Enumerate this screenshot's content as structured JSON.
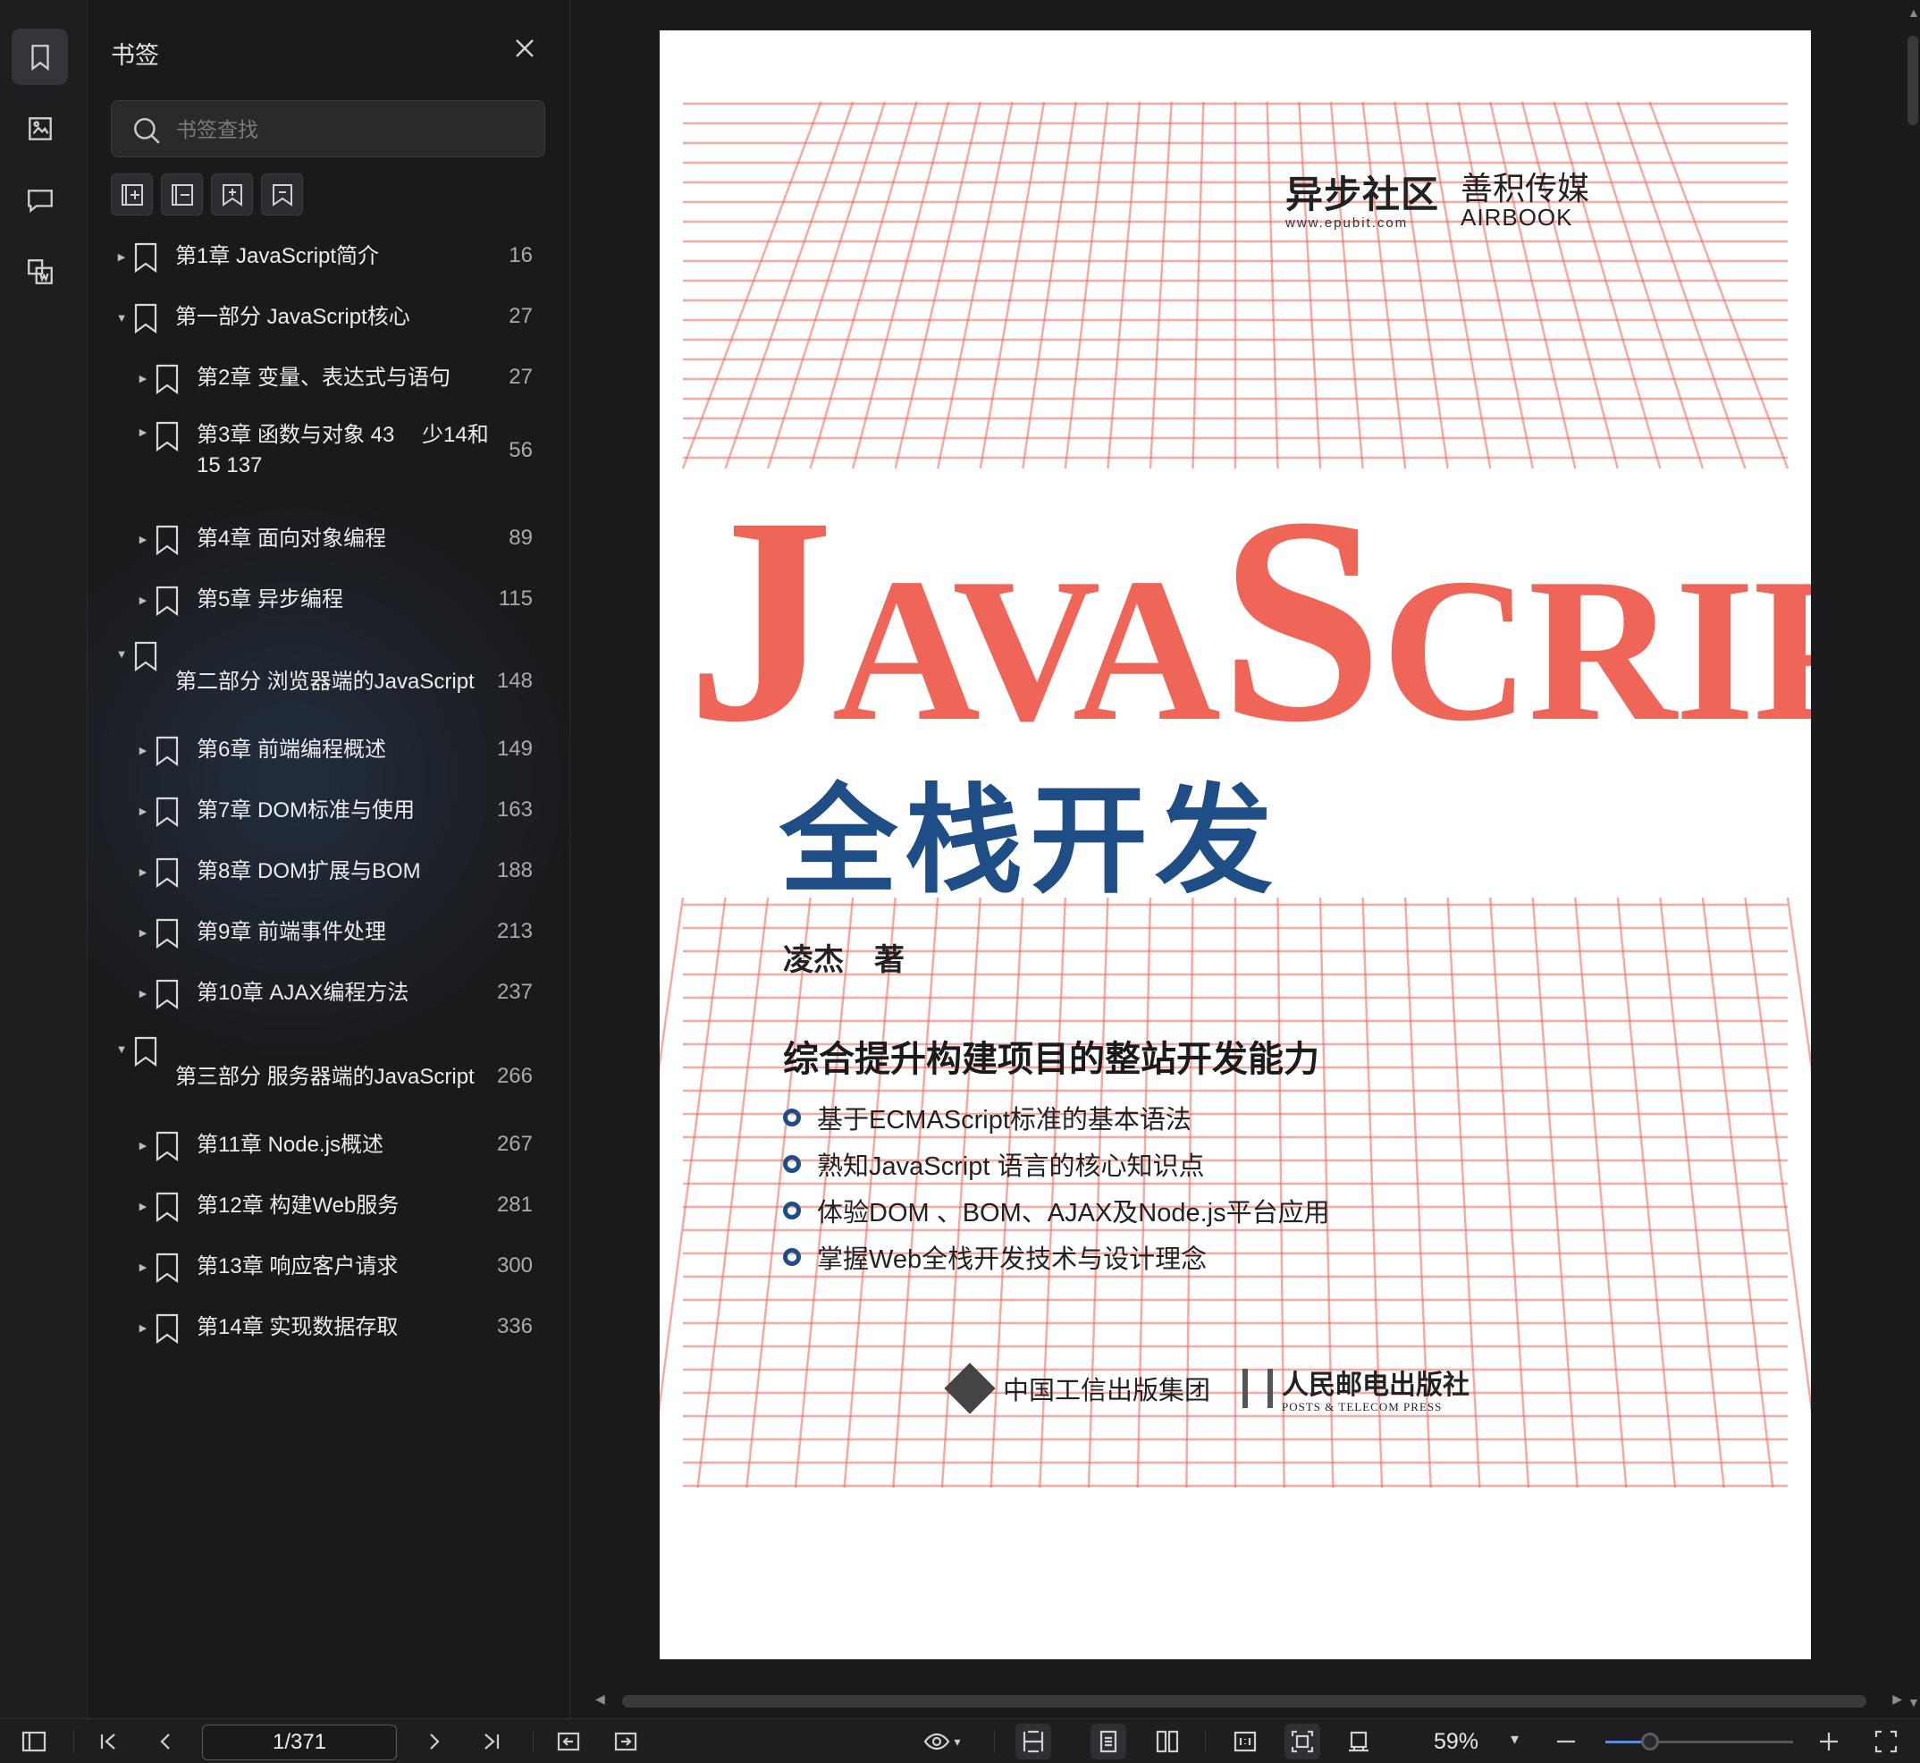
{
  "sidebar": {
    "title": "书签",
    "search_placeholder": "书签查找",
    "rail_icons": [
      "bookmark-icon",
      "image-icon",
      "comment-icon",
      "extract-icon"
    ],
    "tool_icons": [
      "expand-all-icon",
      "collapse-all-icon",
      "add-bookmark-icon",
      "remove-bookmark-icon"
    ]
  },
  "bookmarks": [
    {
      "label": "第1章 JavaScript简介",
      "page": "16",
      "level": 0,
      "expanded": false
    },
    {
      "label": "第一部分 JavaScript核心",
      "page": "27",
      "level": 0,
      "expanded": true
    },
    {
      "label": "第2章 变量、表达式与语句",
      "page": "27",
      "level": 1,
      "expanded": false
    },
    {
      "label": "第3章 函数与对象 43　 少14和\n15  137",
      "page": "56",
      "level": 1,
      "expanded": false
    },
    {
      "label": "第4章 面向对象编程",
      "page": "89",
      "level": 1,
      "expanded": false
    },
    {
      "label": "第5章 异步编程",
      "page": "115",
      "level": 1,
      "expanded": false
    },
    {
      "label": "第二部分 浏览器端的JavaScript",
      "page": "148",
      "level": 0,
      "expanded": true
    },
    {
      "label": "第6章 前端编程概述",
      "page": "149",
      "level": 1,
      "expanded": false
    },
    {
      "label": "第7章 DOM标准与使用",
      "page": "163",
      "level": 1,
      "expanded": false
    },
    {
      "label": "第8章 DOM扩展与BOM",
      "page": "188",
      "level": 1,
      "expanded": false
    },
    {
      "label": "第9章 前端事件处理",
      "page": "213",
      "level": 1,
      "expanded": false
    },
    {
      "label": "第10章 AJAX编程方法",
      "page": "237",
      "level": 1,
      "expanded": false
    },
    {
      "label": "第三部分 服务器端的JavaScript",
      "page": "266",
      "level": 0,
      "expanded": true
    },
    {
      "label": "第11章 Node.js概述",
      "page": "267",
      "level": 1,
      "expanded": false
    },
    {
      "label": "第12章 构建Web服务",
      "page": "281",
      "level": 1,
      "expanded": false
    },
    {
      "label": "第13章 响应客户请求",
      "page": "300",
      "level": 1,
      "expanded": false
    },
    {
      "label": "第14章 实现数据存取",
      "page": "336",
      "level": 1,
      "expanded": false
    }
  ],
  "cover": {
    "publisher_top_1": "异步社区",
    "publisher_top_1_url": "www.epubit.com",
    "publisher_top_2": "善积传媒",
    "publisher_top_2_en": "AIRBOOK",
    "title_parts": [
      "J",
      "AVA",
      "S",
      "CRIPT"
    ],
    "subtitle": "全栈开发",
    "author": "凌杰　著",
    "slogan": "综合提升构建项目的整站开发能力",
    "bullets": [
      "基于ECMAScript标准的基本语法",
      "熟知JavaScript 语言的核心知识点",
      "体验DOM 、BOM、AJAX及Node.js平台应用",
      "掌握Web全栈开发技术与设计理念"
    ],
    "publisher_bottom_1": "中国工信出版集团",
    "publisher_bottom_2": "人民邮电出版社",
    "publisher_bottom_2_en": "POSTS & TELECOM PRESS",
    "accent_color": "#ef6557",
    "blue_color": "#1f4e86"
  },
  "toolbar": {
    "page_indicator": "1/371",
    "zoom": "59%",
    "zoom_fraction": 0.24
  }
}
